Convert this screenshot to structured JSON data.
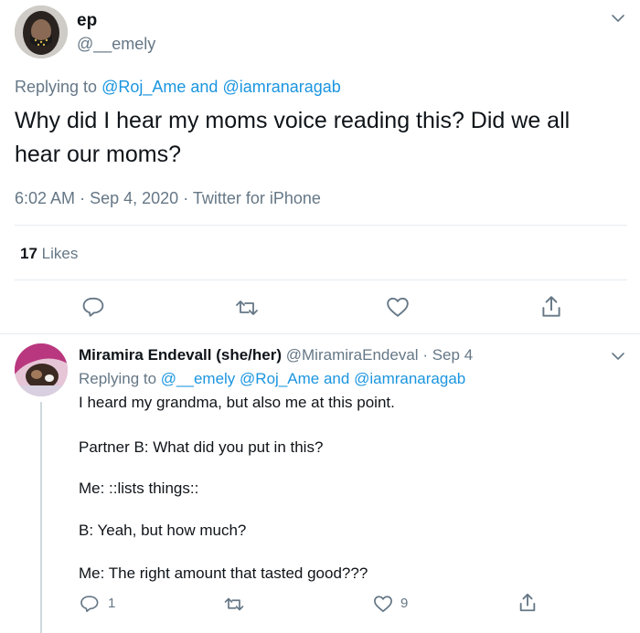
{
  "main_tweet": {
    "author_name": "ep",
    "author_handle": "@__emely",
    "replying_prefix": "Replying to",
    "replying_user1": "@Roj_Ame",
    "replying_and": "and",
    "replying_user2": "@iamranaragab",
    "text_line1": "Why did I hear my moms voice reading this? Did we all",
    "text_line2": "hear our moms?",
    "time": "6:02 AM",
    "date": "Sep 4, 2020",
    "source": "Twitter for iPhone",
    "likes_count": "17",
    "likes_label": "Likes"
  },
  "reply_tweet": {
    "author_name": "Miramira Endevall (she/her)",
    "author_handle": "@MiramiraEndeval",
    "date": "Sep 4",
    "replying_prefix": "Replying to",
    "replying_user1": "@__emely",
    "replying_user2": "@Roj_Ame",
    "replying_and": "and",
    "replying_user3": "@iamranaragab",
    "lines": [
      "I heard my grandma, but also me at this point.",
      "Partner B: What did you put in this?",
      "Me: ::lists things::",
      "B: Yeah, but how much?",
      "Me: The right amount that tasted good???"
    ],
    "reply_count": "1",
    "like_count": "9"
  },
  "separator": "·",
  "colors": {
    "link": "#1b95e0",
    "secondary": "#657786",
    "divider": "#e6ecf0",
    "text": "#0f1419"
  },
  "icons": [
    "chevron-down-icon",
    "reply-icon",
    "retweet-icon",
    "like-icon",
    "share-icon"
  ]
}
